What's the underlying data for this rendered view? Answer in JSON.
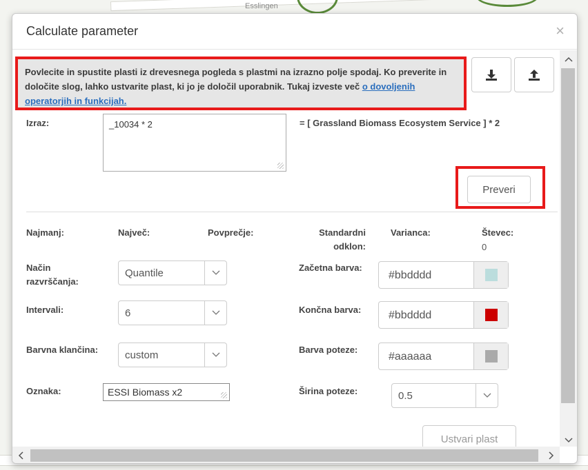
{
  "map": {
    "label_top": "Esslingen"
  },
  "dialog": {
    "title": "Calculate parameter",
    "close": "×",
    "info": {
      "text": "Povlecite in spustite plasti iz drevesnega pogleda s plastmi na izrazno polje spodaj. Ko preverite in določite slog, lahko ustvarite plast, ki jo je določil uporabnik. Tukaj izveste več ",
      "link": "o dovoljenih operatorjih in funkcijah."
    },
    "icons": {
      "download": "download-icon",
      "upload": "upload-icon"
    },
    "expression": {
      "label": "Izraz:",
      "value": "_10034 * 2",
      "resolved": "= [ Grassland Biomass Ecosystem Service ] * 2"
    },
    "check_button": "Preveri",
    "stats": {
      "min_label": "Najmanj:",
      "max_label": "Največ:",
      "mean_label": "Povprečje:",
      "std_label": "Standardni odklon:",
      "var_label": "Varianca:",
      "count_label": "Števec:",
      "count_value": "0"
    },
    "classification": {
      "label": "Način razvrščanja:",
      "value": "Quantile"
    },
    "intervals": {
      "label": "Intervali:",
      "value": "6"
    },
    "ramp": {
      "label": "Barvna klančina:",
      "value": "custom"
    },
    "start_color": {
      "label": "Začetna barva:",
      "value": "#bbdddd",
      "swatch": "#bbdddd"
    },
    "end_color": {
      "label": "Končna barva:",
      "value": "#bbdddd",
      "swatch": "#cc0000"
    },
    "stroke_color": {
      "label": "Barva poteze:",
      "value": "#aaaaaa",
      "swatch": "#aaaaaa"
    },
    "name": {
      "label": "Oznaka:",
      "value": "ESSI Biomass x2"
    },
    "stroke_width": {
      "label": "Širina poteze:",
      "value": "0.5"
    },
    "create_button": "Ustvari plast"
  },
  "colors": {
    "highlight": "#e81a1a",
    "link": "#2a6ebd"
  }
}
